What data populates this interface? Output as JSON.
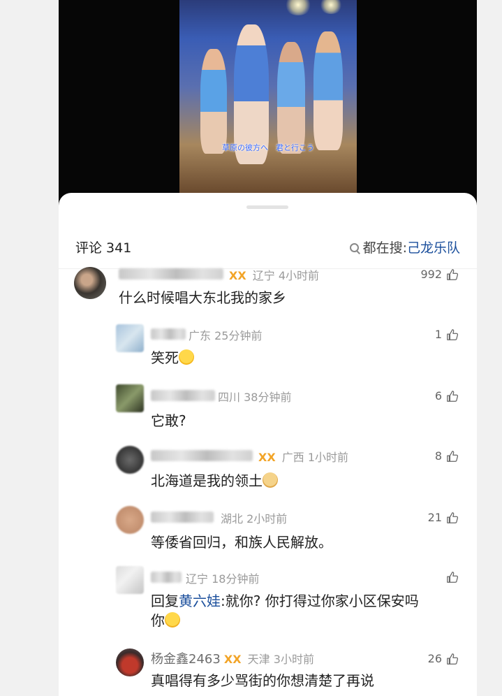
{
  "video": {
    "subtitle": "草原の彼方へ　君と行こう"
  },
  "header": {
    "comment_title": "评论 341",
    "hot_search_prefix": "都在搜:",
    "hot_search_keyword": "己龙乐队"
  },
  "comments": [
    {
      "location": "辽宁",
      "time": "4小时前",
      "likes": "992",
      "text": "什么时候唱大东北我的家乡",
      "badge": "ⅩⅩ"
    },
    {
      "location": "广东",
      "time": "25分钟前",
      "likes": "1",
      "text": "笑死",
      "emoji": "crying-laughing-emoji"
    },
    {
      "location": "四川",
      "time": "38分钟前",
      "likes": "6",
      "text": "它敢?"
    },
    {
      "location": "广西",
      "time": "1小时前",
      "likes": "8",
      "text": "北海道是我的领土",
      "emoji": "doge-emoji",
      "badge": "ⅩⅩ"
    },
    {
      "location": "湖北",
      "time": "2小时前",
      "likes": "21",
      "text": "等倭省回归，和族人民解放。"
    },
    {
      "location": "辽宁",
      "time": "18分钟前",
      "likes": "",
      "reply_prefix": "回复",
      "reply_to": "黄六娃",
      "text_line1": ":就你?  你打得过你家小区保安吗",
      "text_line2": "你",
      "emoji": "grinning-emoji"
    },
    {
      "username": "杨金鑫2463",
      "location": "天津",
      "time": "3小时前",
      "likes": "26",
      "text": "真唱得有多少骂街的你想清楚了再说",
      "badge": "ⅩⅩ"
    }
  ],
  "colors": {
    "link": "#1b4f9c",
    "badge": "#f2a427",
    "meta": "#9a9a9a"
  }
}
